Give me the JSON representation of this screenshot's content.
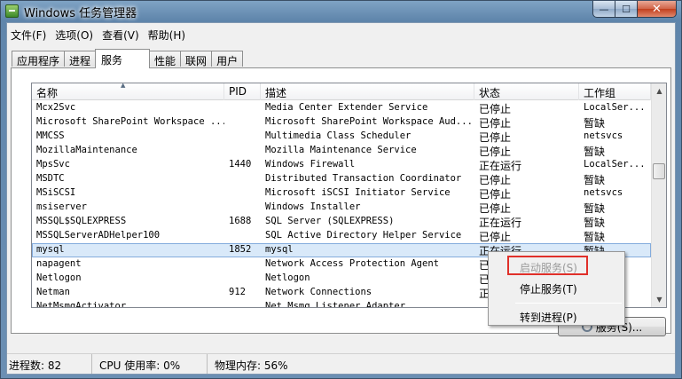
{
  "window": {
    "title": "Windows 任务管理器",
    "min_glyph": "—",
    "max_glyph": "☐",
    "close_glyph": "✕"
  },
  "menu": [
    "文件(F)",
    "选项(O)",
    "查看(V)",
    "帮助(H)"
  ],
  "tabs": [
    "应用程序",
    "进程",
    "服务",
    "性能",
    "联网",
    "用户"
  ],
  "active_tab": "服务",
  "columns": [
    "名称",
    "PID",
    "描述",
    "状态",
    "工作组"
  ],
  "rows": [
    {
      "name": "Mcx2Svc",
      "pid": "",
      "desc": "Media Center Extender Service",
      "status": "已停止",
      "group": "LocalSer..."
    },
    {
      "name": "Microsoft SharePoint Workspace ...",
      "pid": "",
      "desc": "Microsoft SharePoint Workspace Aud...",
      "status": "已停止",
      "group": "暂缺"
    },
    {
      "name": "MMCSS",
      "pid": "",
      "desc": "Multimedia Class Scheduler",
      "status": "已停止",
      "group": "netsvcs"
    },
    {
      "name": "MozillaMaintenance",
      "pid": "",
      "desc": "Mozilla Maintenance Service",
      "status": "已停止",
      "group": "暂缺"
    },
    {
      "name": "MpsSvc",
      "pid": "1440",
      "desc": "Windows Firewall",
      "status": "正在运行",
      "group": "LocalSer..."
    },
    {
      "name": "MSDTC",
      "pid": "",
      "desc": "Distributed Transaction Coordinator",
      "status": "已停止",
      "group": "暂缺"
    },
    {
      "name": "MSiSCSI",
      "pid": "",
      "desc": "Microsoft iSCSI Initiator Service",
      "status": "已停止",
      "group": "netsvcs"
    },
    {
      "name": "msiserver",
      "pid": "",
      "desc": "Windows Installer",
      "status": "已停止",
      "group": "暂缺"
    },
    {
      "name": "MSSQL$SQLEXPRESS",
      "pid": "1688",
      "desc": "SQL Server (SQLEXPRESS)",
      "status": "正在运行",
      "group": "暂缺"
    },
    {
      "name": "MSSQLServerADHelper100",
      "pid": "",
      "desc": "SQL Active Directory Helper Service",
      "status": "已停止",
      "group": "暂缺"
    },
    {
      "name": "mysql",
      "pid": "1852",
      "desc": "mysql",
      "status": "正在运行",
      "group": "暂缺",
      "selected": true
    },
    {
      "name": "napagent",
      "pid": "",
      "desc": "Network Access Protection Agent",
      "status": "已停",
      "group": ""
    },
    {
      "name": "Netlogon",
      "pid": "",
      "desc": "Netlogon",
      "status": "已停",
      "group": ""
    },
    {
      "name": "Netman",
      "pid": "912",
      "desc": "Network Connections",
      "status": "正在",
      "group": ""
    },
    {
      "name": "NetMsmqActivator",
      "pid": "",
      "desc": "Net.Msmq Listener Adapter",
      "status": "",
      "group": ""
    }
  ],
  "services_button": "服务(S)...",
  "status_bar": {
    "processes": "进程数: 82",
    "cpu": "CPU 使用率: 0%",
    "memory": "物理内存: 56%"
  },
  "context_menu": [
    {
      "label": "启动服务(S)",
      "enabled": false
    },
    {
      "label": "停止服务(T)",
      "enabled": true
    },
    {
      "label": "转到进程(P)",
      "enabled": true
    }
  ],
  "colors": {
    "selection": "#d9e9f9",
    "highlight_box": "#e0302a"
  }
}
